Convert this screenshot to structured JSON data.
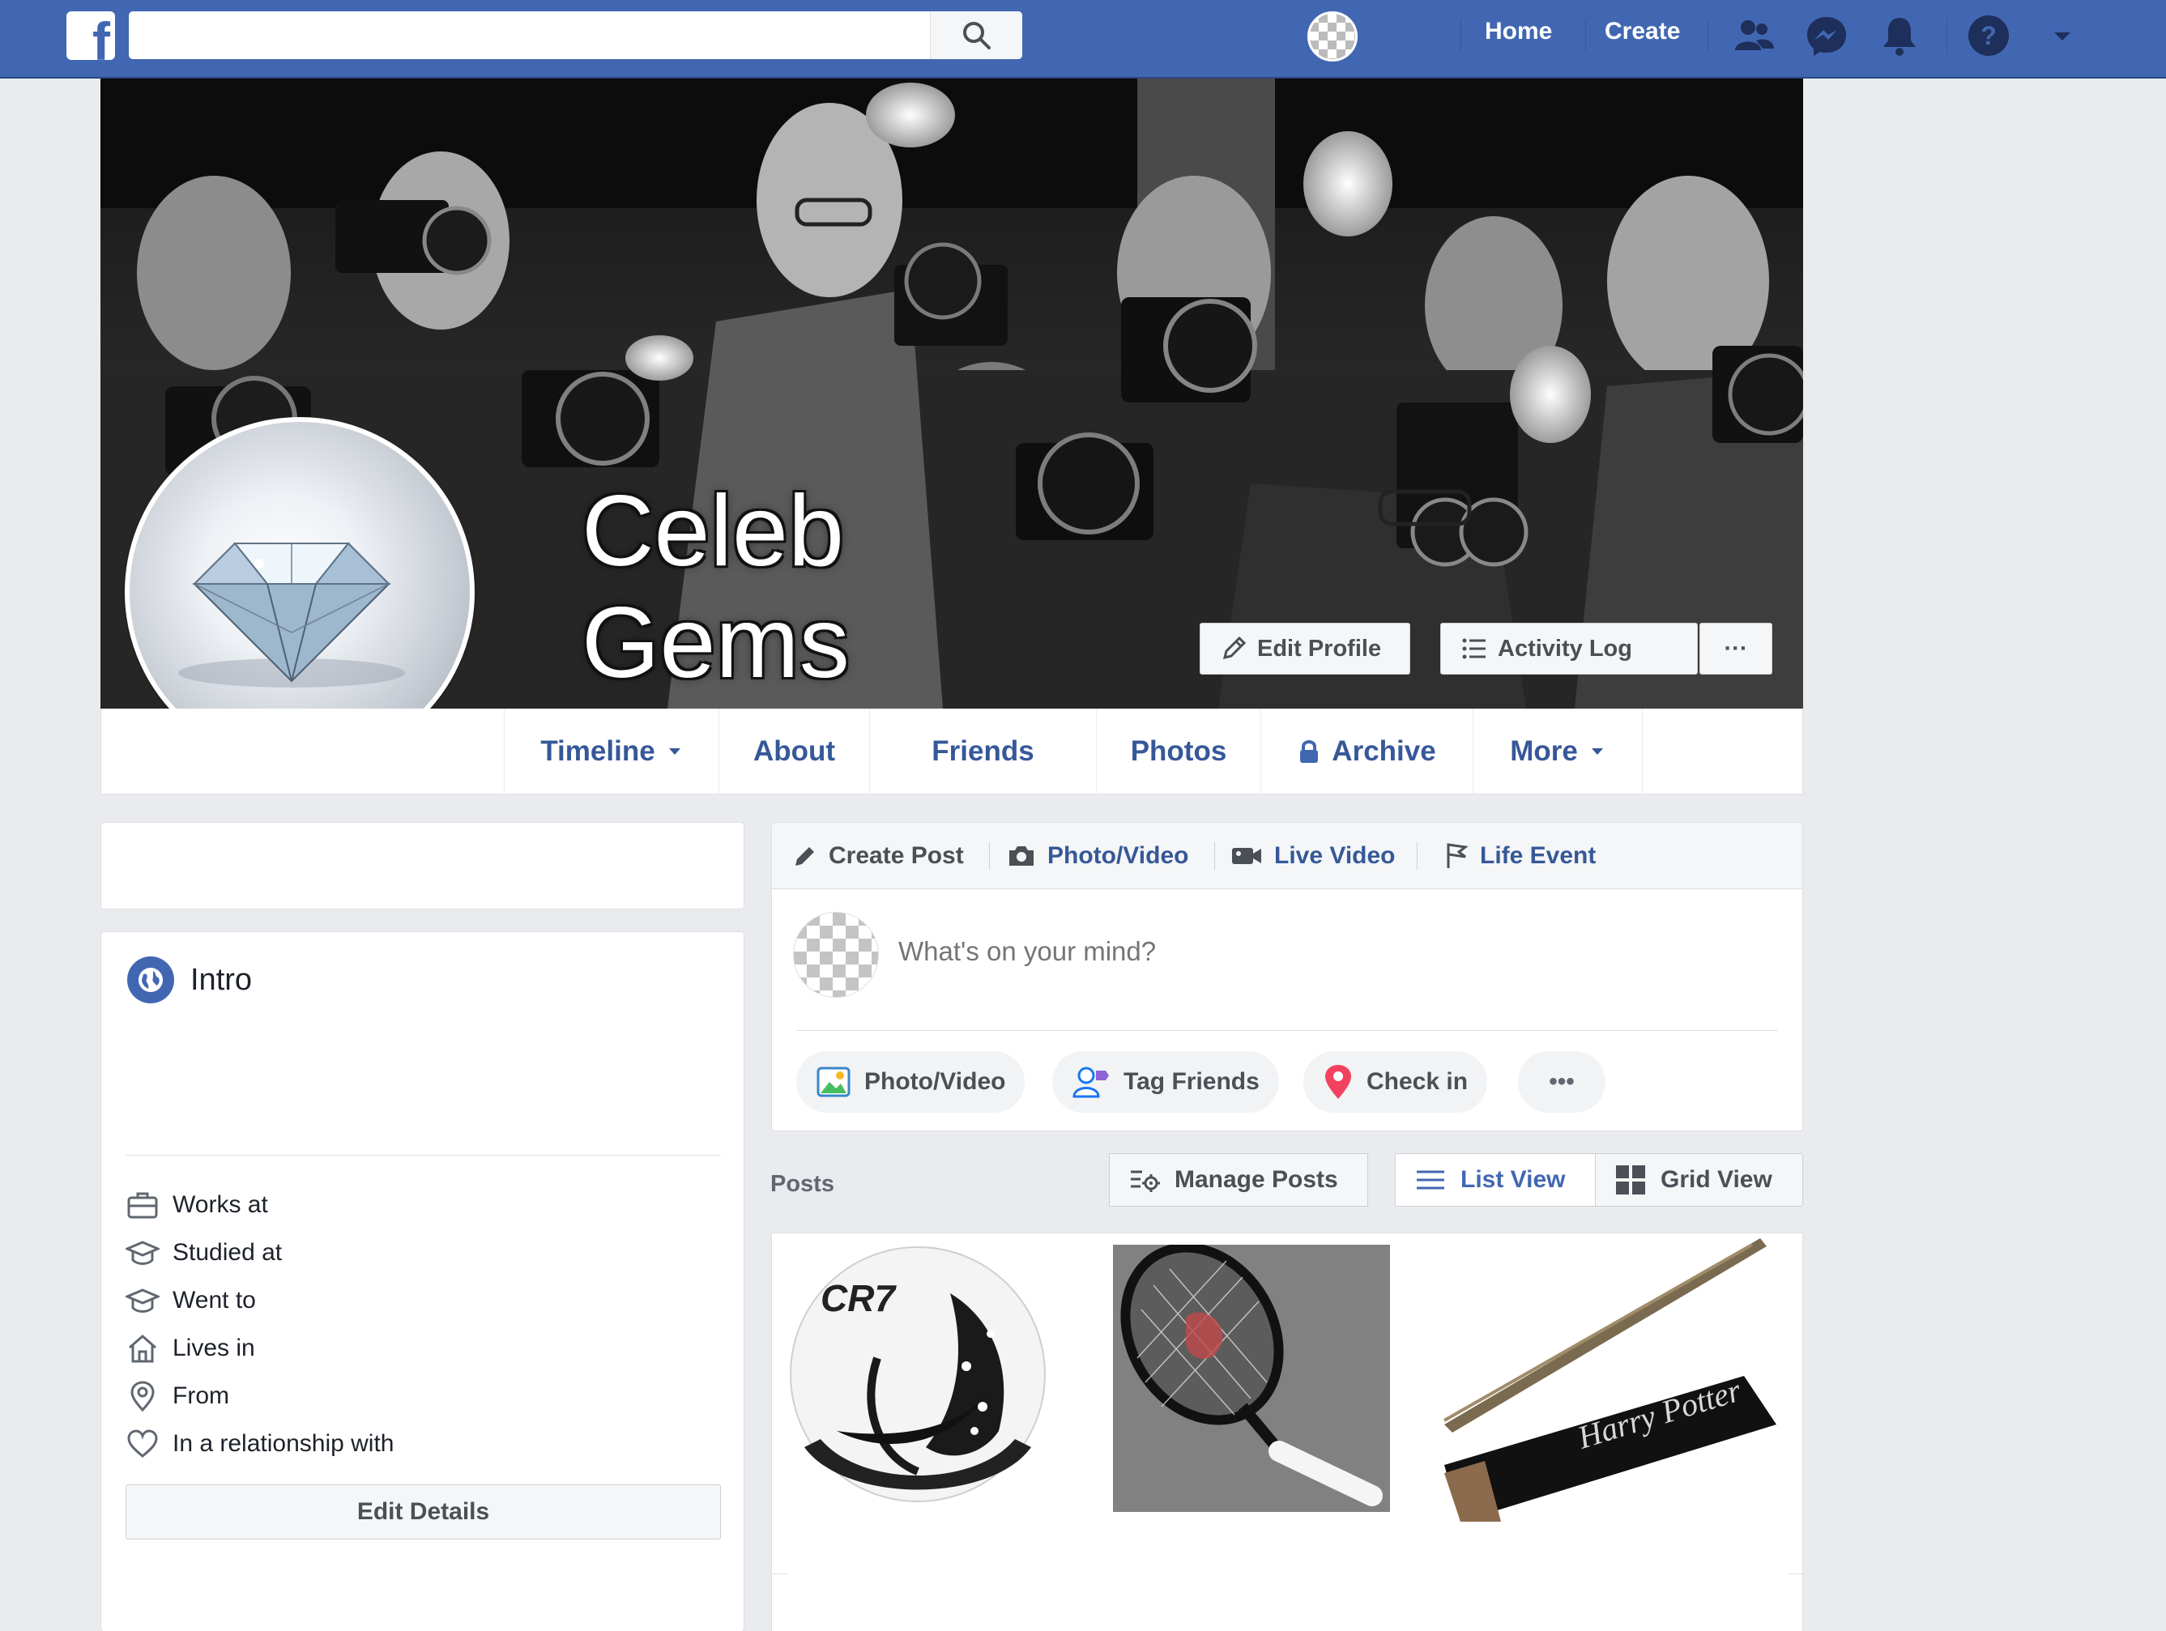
{
  "topbar": {
    "search_value": "",
    "nav": {
      "home": "Home",
      "create": "Create"
    },
    "brand_color": "#4267b2"
  },
  "profile": {
    "name_line1": "Celeb",
    "name_line2": "Gems"
  },
  "cover_actions": {
    "edit_profile": "Edit Profile",
    "activity_log": "Activity Log",
    "more": "···"
  },
  "tabs": {
    "timeline": "Timeline",
    "about": "About",
    "friends": "Friends",
    "photos": "Photos",
    "archive": "Archive",
    "more": "More"
  },
  "intro": {
    "title": "Intro",
    "details": {
      "works_at": "Works at",
      "studied_at": "Studied at",
      "went_to": "Went to",
      "lives_in": "Lives in",
      "from": "From",
      "relationship": "In a relationship with"
    },
    "edit_details": "Edit Details"
  },
  "composer": {
    "tabs": {
      "create_post": "Create Post",
      "photo_video": "Photo/Video",
      "live_video": "Live Video",
      "life_event": "Life Event"
    },
    "placeholder": "What's on your mind?",
    "actions": {
      "photo_video": "Photo/Video",
      "tag_friends": "Tag Friends",
      "check_in": "Check in",
      "more": "•••"
    }
  },
  "posts": {
    "label": "Posts",
    "manage_posts": "Manage Posts",
    "list_view": "List View",
    "grid_view": "Grid View",
    "ball_text": "CR7",
    "box_text": "Harry Potter"
  }
}
